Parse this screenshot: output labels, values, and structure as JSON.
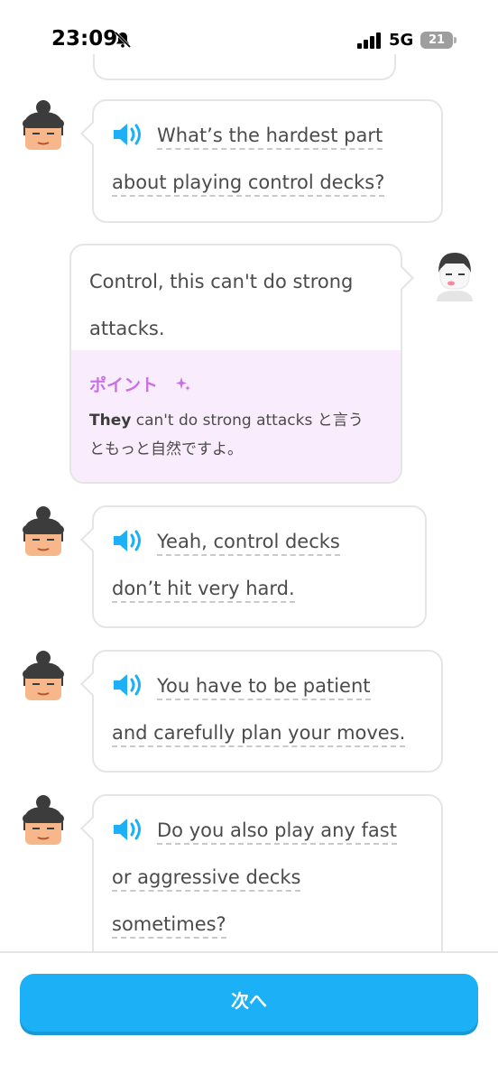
{
  "status_bar": {
    "time": "23:09",
    "network": "5G",
    "battery": "21",
    "icons": [
      "bell-slash-icon",
      "signal-icon"
    ]
  },
  "messages": [
    {
      "speaker": "bot",
      "avatar": "bot-avatar-icon",
      "lines": [
        "What’s the hardest part",
        "about playing control decks?"
      ]
    },
    {
      "speaker": "user",
      "avatar": "user-avatar-icon",
      "text": "Control, this can't do strong attacks.",
      "tip": {
        "title": "ポイント",
        "body_bold": "They",
        "body_rest": " can't do strong attacks と言う",
        "body_line2": "ともっと自然ですよ。"
      }
    },
    {
      "speaker": "bot",
      "lines": [
        "Yeah, control decks",
        "don’t hit very hard."
      ]
    },
    {
      "speaker": "bot",
      "lines": [
        "You have to be patient",
        "and carefully plan your moves."
      ]
    },
    {
      "speaker": "bot",
      "lines": [
        "Do you also play any fast",
        "or aggressive decks",
        "sometimes?"
      ]
    }
  ],
  "footer": {
    "next_label": "次へ"
  },
  "colors": {
    "accent": "#1cb0f6",
    "tip_bg": "#f9ecfc",
    "tip_title": "#c970e6",
    "border": "#e5e5e5"
  }
}
